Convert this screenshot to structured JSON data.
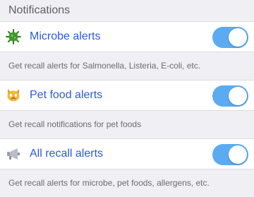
{
  "section": {
    "title": "Notifications"
  },
  "settings": [
    {
      "label": "Microbe alerts",
      "description": "Get recall alerts for Salmonella, Listeria, E-coli, etc.",
      "icon": "microbe-icon",
      "enabled": true
    },
    {
      "label": "Pet food alerts",
      "description": "Get recall notifications for pet foods",
      "icon": "cat-icon",
      "enabled": true
    },
    {
      "label": "All recall alerts",
      "description": "Get recall alerts for microbe, pet foods, allergens, etc.",
      "icon": "megaphone-icon",
      "enabled": true
    }
  ],
  "colors": {
    "toggle_on": "#5aabf2",
    "label": "#2a5bd7"
  }
}
